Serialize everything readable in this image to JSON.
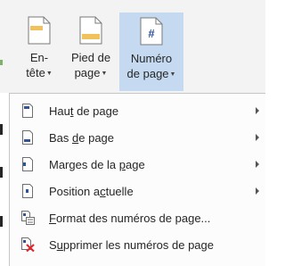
{
  "ribbon": {
    "buttons": [
      {
        "line1": "En-",
        "line2": "tête"
      },
      {
        "line1": "Pied de",
        "line2": "page"
      },
      {
        "line1": "Numéro",
        "line2": "de page"
      }
    ],
    "numero_symbol": "#",
    "active_color": "#c5daf1"
  },
  "menu": {
    "items": [
      {
        "pre": "Hau",
        "acc": "t",
        "post": " de page",
        "icon": "page-top-icon",
        "submenu": true
      },
      {
        "pre": "Bas ",
        "acc": "d",
        "post": "e page",
        "icon": "page-bottom-icon",
        "submenu": true
      },
      {
        "pre": "Marges de la ",
        "acc": "p",
        "post": "age",
        "icon": "page-margins-icon",
        "submenu": true
      },
      {
        "pre": "Position a",
        "acc": "c",
        "post": "tuelle",
        "icon": "current-position-icon",
        "submenu": true
      },
      {
        "pre": "",
        "acc": "F",
        "post": "ormat des numéros de page...",
        "icon": "format-page-numbers-icon",
        "submenu": false
      },
      {
        "pre": "S",
        "acc": "u",
        "post": "pprimer les numéros de page",
        "icon": "remove-page-numbers-icon",
        "submenu": false
      }
    ]
  }
}
